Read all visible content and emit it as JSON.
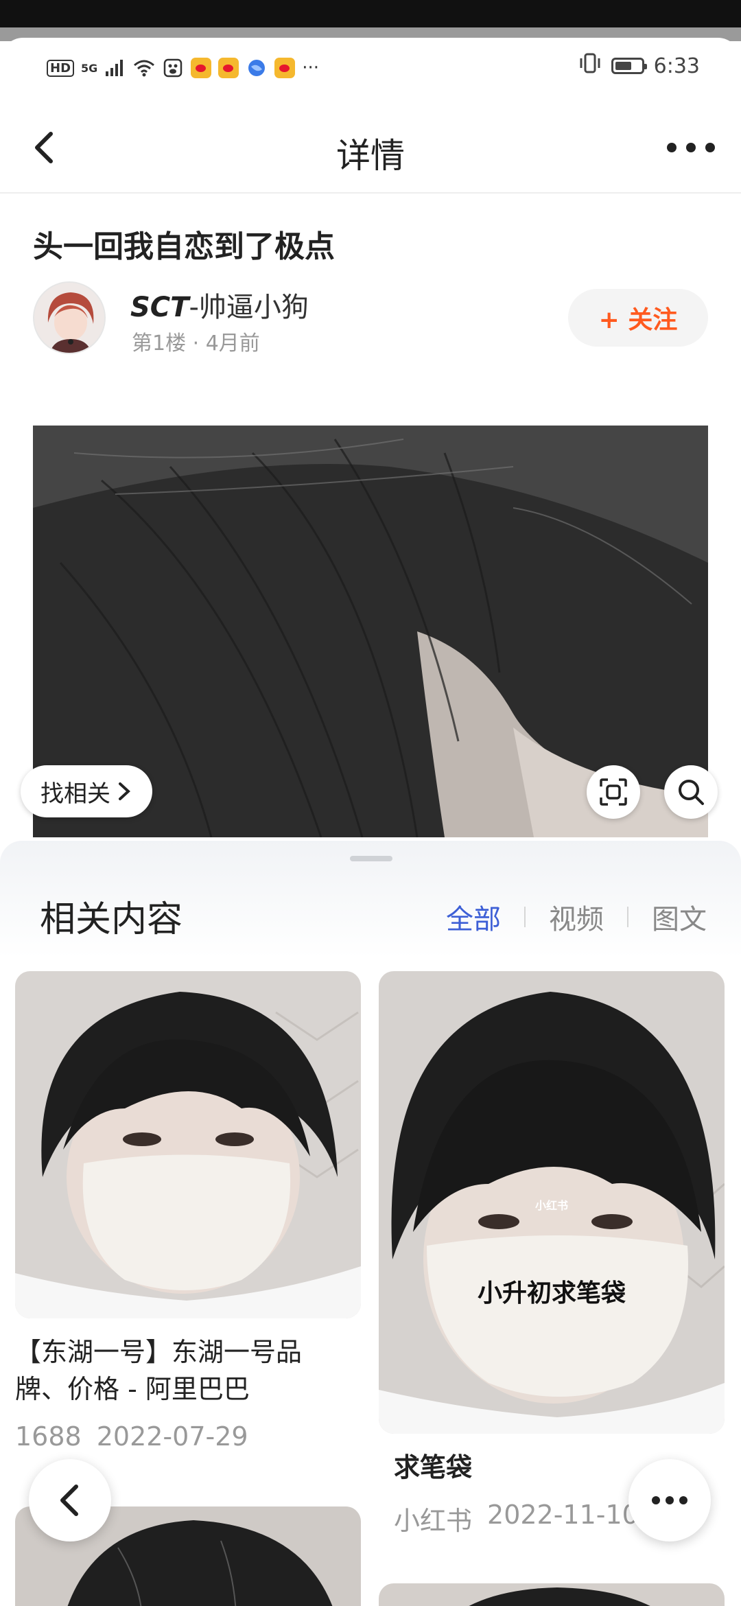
{
  "status_bar": {
    "hd": "HD",
    "network": "5G",
    "time": "6:33",
    "more": "···",
    "icons": [
      "signal-icon",
      "wifi-icon",
      "app-icon",
      "weibo-icon",
      "weibo-icon",
      "browser-icon",
      "weibo-icon",
      "vibrate-icon",
      "battery-icon"
    ]
  },
  "header": {
    "title": "详情",
    "back_icon": "chevron-left-icon",
    "more_icon": "more-dots-icon"
  },
  "post": {
    "title": "头一回我自恋到了极点",
    "author_prefix": "SCT",
    "author_suffix": "-帅逼小狗",
    "meta": "第1楼 · 4月前",
    "follow_label": "+ 关注"
  },
  "image_actions": {
    "find_related": "找相关",
    "scan_icon": "scan-icon",
    "search_icon": "search-icon"
  },
  "related": {
    "title": "相关内容",
    "tabs": [
      {
        "label": "全部",
        "active": true
      },
      {
        "label": "视频",
        "active": false
      },
      {
        "label": "图文",
        "active": false
      }
    ],
    "items": [
      {
        "title": "【东湖一号】东湖一号品牌、价格 - 阿里巴巴",
        "source": "1688",
        "date": "2022-07-29"
      },
      {
        "title": "求笔袋",
        "source": "小红书",
        "date": "2022-11-10",
        "image_caption": "小升初求笔袋",
        "image_watermark": "小红书"
      }
    ]
  },
  "colors": {
    "accent_blue": "#3d5fd6",
    "follow_orange": "#ff5a1f",
    "muted_text": "#999999"
  }
}
